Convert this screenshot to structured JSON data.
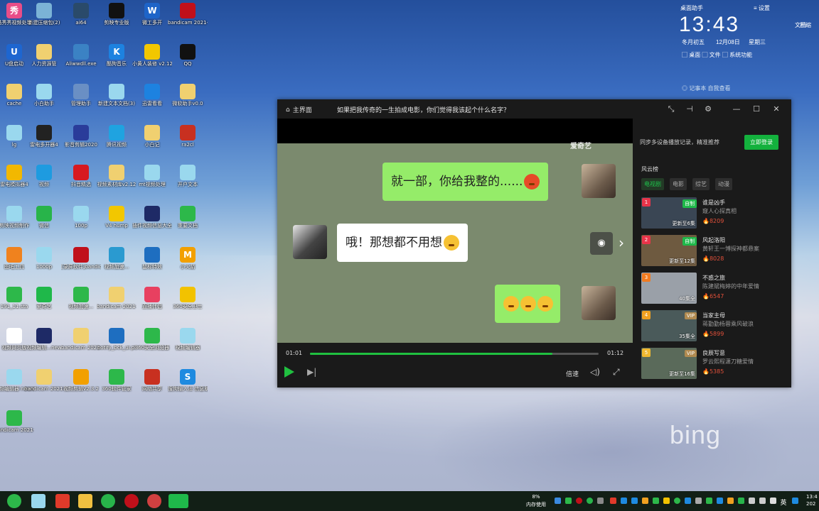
{
  "desktop": {
    "icons": [
      {
        "label": "酷秀秀视频处理",
        "short": "秀",
        "color": "#e84d88"
      },
      {
        "label": "新建压缩包(2)",
        "short": "",
        "color": "#7bb3d6"
      },
      {
        "label": "ai64",
        "short": "",
        "color": "#2a4a6a"
      },
      {
        "label": "剪映专业版",
        "short": "",
        "color": "#111111"
      },
      {
        "label": "微工多开",
        "short": "W",
        "color": "#1e64c8"
      },
      {
        "label": "bandicam 2021-12-0...",
        "short": "",
        "color": "#c0101a"
      },
      {
        "label": "U盘启动",
        "short": "U",
        "color": "#1e66d0"
      },
      {
        "label": "人力资源管",
        "short": "",
        "color": "#f0d070"
      },
      {
        "label": "Aliwwdll.exe",
        "short": "",
        "color": "#3b82c4"
      },
      {
        "label": "酷狗音乐",
        "short": "K",
        "color": "#1d82e0"
      },
      {
        "label": "小黄人装修 v2.12",
        "short": "",
        "color": "#f2c700"
      },
      {
        "label": "QQ",
        "short": "",
        "color": "#111111"
      },
      {
        "label": "cache",
        "short": "",
        "color": "#f0d070"
      },
      {
        "label": "小白助手",
        "short": "",
        "color": "#9ad8ee"
      },
      {
        "label": "管理助手",
        "short": "",
        "color": "#6a8fc4"
      },
      {
        "label": "新建文本文档(3)",
        "short": "",
        "color": "#9ad8ee"
      },
      {
        "label": "迅雷看看",
        "short": "",
        "color": "#1d82e0"
      },
      {
        "label": "微软助手v0.0",
        "short": "",
        "color": "#f0d070"
      },
      {
        "label": "lg",
        "short": "",
        "color": "#9ad8ee"
      },
      {
        "label": "雷电多开器4",
        "short": "",
        "color": "#222222"
      },
      {
        "label": "影音剪辑2020",
        "short": "",
        "color": "#2a3c9a"
      },
      {
        "label": "腾讯视频",
        "short": "",
        "color": "#1fa3e0"
      },
      {
        "label": "小白记",
        "short": "",
        "color": "#f0d070"
      },
      {
        "label": "ra2cl",
        "short": "",
        "color": "#c83020"
      },
      {
        "label": "雷电模拟器4",
        "short": "",
        "color": "#f2b800"
      },
      {
        "label": "视频",
        "short": "",
        "color": "#1e9be0"
      },
      {
        "label": "抖音精选",
        "short": "",
        "color": "#d71920"
      },
      {
        "label": "视频素材库v2.12",
        "short": "",
        "color": "#f0d070"
      },
      {
        "label": "mt视频处理",
        "short": "",
        "color": "#9ad8ee"
      },
      {
        "label": "开户文本",
        "short": "",
        "color": "#9ad8ee"
      },
      {
        "label": "剪映视频制作",
        "short": "",
        "color": "#9ad8ee"
      },
      {
        "label": "微信",
        "short": "",
        "color": "#28b44a"
      },
      {
        "label": "100p",
        "short": "",
        "color": "#9ad8ee"
      },
      {
        "label": "V4 hump",
        "short": "",
        "color": "#f2c700"
      },
      {
        "label": "插件视频信息大全",
        "short": "",
        "color": "#1e2a66"
      },
      {
        "label": "重要文档",
        "short": "",
        "color": "#2db84a"
      },
      {
        "label": "图吧工具",
        "short": "",
        "color": "#f0821e"
      },
      {
        "label": "1000p",
        "short": "",
        "color": "#9ad8ee"
      },
      {
        "label": "[录屏软件]bandicam",
        "short": "",
        "color": "#c0101a"
      },
      {
        "label": "视频加速...",
        "short": "",
        "color": "#2a9ad0"
      },
      {
        "label": "鼠标特效",
        "short": "",
        "color": "#1e6ec0"
      },
      {
        "label": "小火箭",
        "short": "M",
        "color": "#f2a000"
      },
      {
        "label": "191_11.sta",
        "short": "",
        "color": "#2db84a"
      },
      {
        "label": "爱奇艺",
        "short": "",
        "color": "#1fb84a"
      },
      {
        "label": "视频加速...",
        "short": "",
        "color": "#2db84a"
      },
      {
        "label": "bandicam 2021-12-0...",
        "short": "",
        "color": "#f0d070"
      },
      {
        "label": "直播伴侣",
        "short": "",
        "color": "#e84060"
      },
      {
        "label": "360安全卫士",
        "short": "",
        "color": "#f2c200"
      },
      {
        "label": "视频网页版",
        "short": "",
        "color": "#ffffff"
      },
      {
        "label": "视频编辑...new",
        "short": "",
        "color": "#1e2a66"
      },
      {
        "label": "bandicam 2021-12-0...",
        "short": "",
        "color": "#f0d070"
      },
      {
        "label": "notify_bck_ui.pl",
        "short": "",
        "color": "#1e6ec0"
      },
      {
        "label": "360安全浏览器",
        "short": "",
        "color": "#2db84a"
      },
      {
        "label": "視频编辑器",
        "short": "",
        "color": "#9ad8ee"
      },
      {
        "label": "视频编辑器 new.exe",
        "short": "",
        "color": "#9ad8ee"
      },
      {
        "label": "bandicam 2021-12-0...",
        "short": "",
        "color": "#f0d070"
      },
      {
        "label": "视频剪辑v2.3.2",
        "short": "",
        "color": "#f2a000"
      },
      {
        "label": "360软件管家",
        "short": "",
        "color": "#2db84a"
      },
      {
        "label": "网络共享",
        "short": "",
        "color": "#c83020"
      },
      {
        "label": "搜狗输入法 信息助手",
        "short": "S",
        "color": "#1e8ae0"
      },
      {
        "label": "bandicam 2021-12-0...",
        "short": "",
        "color": "#2db84a"
      }
    ]
  },
  "widget": {
    "title": "桌面助手",
    "menu": "≡ 设置",
    "clock": "13:43",
    "lunar": "冬月初五",
    "date": "12月08日",
    "weekday": "星期三",
    "links": "▢ 桌面   ▢ 文件   ▢ 系统功能",
    "row3": "◎ 记事本 自我查看",
    "right1": "压缩",
    "right2": "文档"
  },
  "player": {
    "home_label": "主界面",
    "video_title": "如果把我传奇的一生拍成电影，你们觉得我该起个什么名字？",
    "watermark": "爱奇艺",
    "chat": {
      "msg1": "就一部，你给我整的......",
      "msg2": "哦！那想都不用想"
    },
    "time_current": "01:01",
    "time_total": "01:12",
    "progress": 0.84,
    "speed_label": "倍速",
    "side": {
      "sync_text": "同步多设备播放记录，精准推荐",
      "login_button": "立即登录",
      "section_title": "风云榜",
      "tabs": [
        "电视剧",
        "电影",
        "综艺",
        "动漫"
      ],
      "items": [
        {
          "num": "1",
          "name": "谁是凶手",
          "desc": "窥人心探真相",
          "heat": "8209",
          "badge": "自制",
          "ep": "更新至6集",
          "numcolor": "#e8344a",
          "badgecolor": "#1fb84a",
          "thumb": "#3a4654"
        },
        {
          "num": "2",
          "name": "风起洛阳",
          "desc": "黄轩王一博探神都悬案",
          "heat": "8028",
          "badge": "自制",
          "ep": "更新至12集",
          "numcolor": "#e8344a",
          "badgecolor": "#1fb84a",
          "thumb": "#6e5a40"
        },
        {
          "num": "3",
          "name": "不惑之旅",
          "desc": "陈建斌梅婷的中年爱情",
          "heat": "6547",
          "badge": "",
          "ep": "40集全",
          "numcolor": "#f07a20",
          "badgecolor": "",
          "thumb": "#9aa0a8"
        },
        {
          "num": "4",
          "name": "当家主母",
          "desc": "蒋勤勤杨蓉乘风破浪",
          "heat": "5899",
          "badge": "VIP",
          "ep": "35集全",
          "numcolor": "#f0a020",
          "badgecolor": "#b08a50",
          "thumb": "#4a5a5a"
        },
        {
          "num": "5",
          "name": "良辰写意",
          "desc": "罗云熙程潇刀糖爱情",
          "heat": "5385",
          "badge": "VIP",
          "ep": "更新至16集",
          "numcolor": "#f0b830",
          "badgecolor": "#b08a50",
          "thumb": "#5a6a5a"
        }
      ]
    }
  },
  "taskbar": {
    "mem_percent": "8%",
    "mem_label": "内存使用",
    "lang": "英",
    "clock": "13:4",
    "date": "202"
  }
}
